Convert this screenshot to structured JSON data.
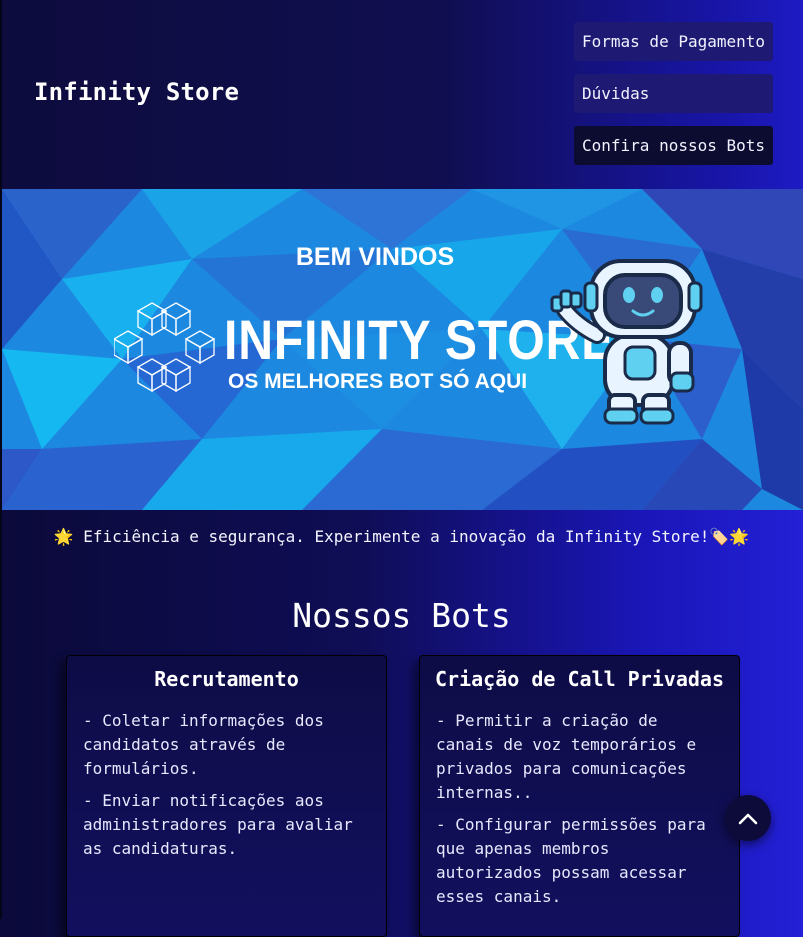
{
  "header": {
    "brand": "Infinity Store",
    "nav": [
      "Formas de Pagamento",
      "Dúvidas",
      "Confira nossos Bots"
    ]
  },
  "banner": {
    "welcome": "BEM VINDOS",
    "title": "INFINITY STORE",
    "subtitle": "OS MELHORES BOT SÓ AQUI"
  },
  "tagline": {
    "emoji_start": "🌟",
    "text": "Eficiência e segurança. Experimente a inovação da Infinity Store!",
    "emoji_end": "🏷️🌟"
  },
  "section_title": "Nossos Bots",
  "bots": [
    {
      "title": "Recrutamento",
      "items": [
        "- Coletar informações dos candidatos através de formulários.",
        "- Enviar notificações aos administradores para avaliar as candidaturas."
      ]
    },
    {
      "title": "Criação de Call Privadas",
      "items": [
        "- Permitir a criação de canais de voz temporários e privados para comunicações internas..",
        "- Configurar permissões para que apenas membros autorizados possam acessar esses canais."
      ]
    }
  ],
  "icons": {
    "scroll_top": "chevron-up-icon",
    "logo": "cube-cluster-icon",
    "mascot": "robot-astronaut"
  },
  "colors": {
    "background_start": "#0b0a3a",
    "background_end": "#2320d6",
    "banner_blue": "#1f8ee0",
    "nav_button": "#1e1a74"
  }
}
